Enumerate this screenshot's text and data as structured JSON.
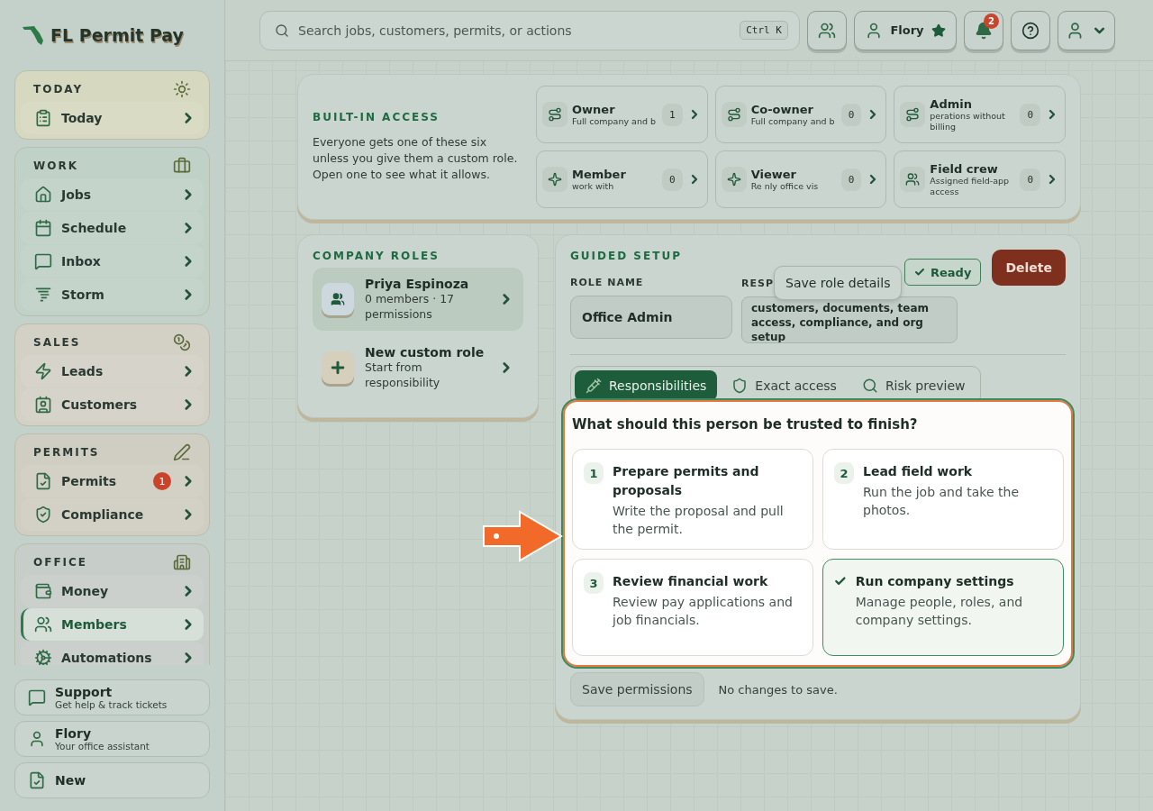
{
  "brand": "FL Permit Pay",
  "sidebar": {
    "sections": [
      {
        "title": "TODAY",
        "items": [
          {
            "label": "Today",
            "selected": false
          }
        ]
      },
      {
        "title": "WORK",
        "items": [
          {
            "label": "Jobs",
            "selected": false
          },
          {
            "label": "Schedule",
            "selected": false
          },
          {
            "label": "Inbox",
            "selected": false
          },
          {
            "label": "Storm",
            "selected": false
          }
        ]
      },
      {
        "title": "SALES",
        "items": [
          {
            "label": "Leads",
            "selected": false
          },
          {
            "label": "Customers",
            "selected": false
          }
        ]
      },
      {
        "title": "PERMITS",
        "items": [
          {
            "label": "Permits",
            "selected": false,
            "badge": "1"
          },
          {
            "label": "Compliance",
            "selected": false
          }
        ]
      },
      {
        "title": "OFFICE",
        "items": [
          {
            "label": "Money",
            "selected": false
          },
          {
            "label": "Members",
            "selected": true
          },
          {
            "label": "Automations",
            "selected": false
          }
        ]
      }
    ],
    "footer": [
      {
        "title": "Support",
        "subtitle": "Get help & track tickets"
      },
      {
        "title": "Flory",
        "subtitle": "Your office assistant"
      },
      {
        "title": "New"
      }
    ]
  },
  "topbar": {
    "search_placeholder": "Search jobs, customers, permits, or actions",
    "shortcut": "Ctrl K",
    "assistant": "Flory",
    "notifications": "2"
  },
  "builtin_access": {
    "title": "BUILT-IN ACCESS",
    "description": "Everyone gets one of these six unless you give them a custom role. Open one to see what it allows.",
    "roles": [
      {
        "name": "Owner",
        "summary": "Full company and b",
        "count": "1"
      },
      {
        "name": "Co-owner",
        "summary": "Full company and b",
        "count": "0"
      },
      {
        "name": "Admin",
        "summary": "perations without billing",
        "count": "0"
      },
      {
        "name": "Member",
        "summary": "work with",
        "count": "0"
      },
      {
        "name": "Viewer",
        "summary": "Re  nly office vis",
        "count": "0"
      },
      {
        "name": "Field crew",
        "summary": "Assigned field-app access",
        "count": "0"
      }
    ]
  },
  "company_roles": {
    "title": "COMPANY ROLES",
    "items": [
      {
        "name": "Priya Espinoza",
        "detail": "0 members · 17 permissions",
        "selected": true,
        "kind": "role"
      },
      {
        "name": "New custom role",
        "detail": "Start from responsibility",
        "selected": false,
        "kind": "new"
      }
    ]
  },
  "guided_setup": {
    "title": "GUIDED SETUP",
    "status": "Ready",
    "delete": "Delete",
    "role_name_label": "ROLE NAME",
    "role_name": "Office Admin",
    "responsibility_label": "RESP",
    "responsibility_value": "customers, documents, team access, compliance, and org setup",
    "tooltip": "Save role details",
    "tabs": [
      {
        "label": "Responsibilities",
        "selected": true
      },
      {
        "label": "Exact access",
        "selected": false
      },
      {
        "label": "Risk preview",
        "selected": false
      }
    ],
    "question": "What should this person be trusted to finish?",
    "options": [
      {
        "number": "1",
        "title": "Prepare permits and proposals",
        "description": "Write the proposal and pull the permit.",
        "selected": false
      },
      {
        "number": "2",
        "title": "Lead field work",
        "description": "Run the job and take the photos.",
        "selected": false
      },
      {
        "number": "3",
        "title": "Review financial work",
        "description": "Review pay applications and job financials.",
        "selected": false
      },
      {
        "title": "Run company settings",
        "description": "Manage people, roles, and company settings.",
        "selected": true
      }
    ],
    "save": "Save permissions",
    "save_note": "No changes to save."
  }
}
